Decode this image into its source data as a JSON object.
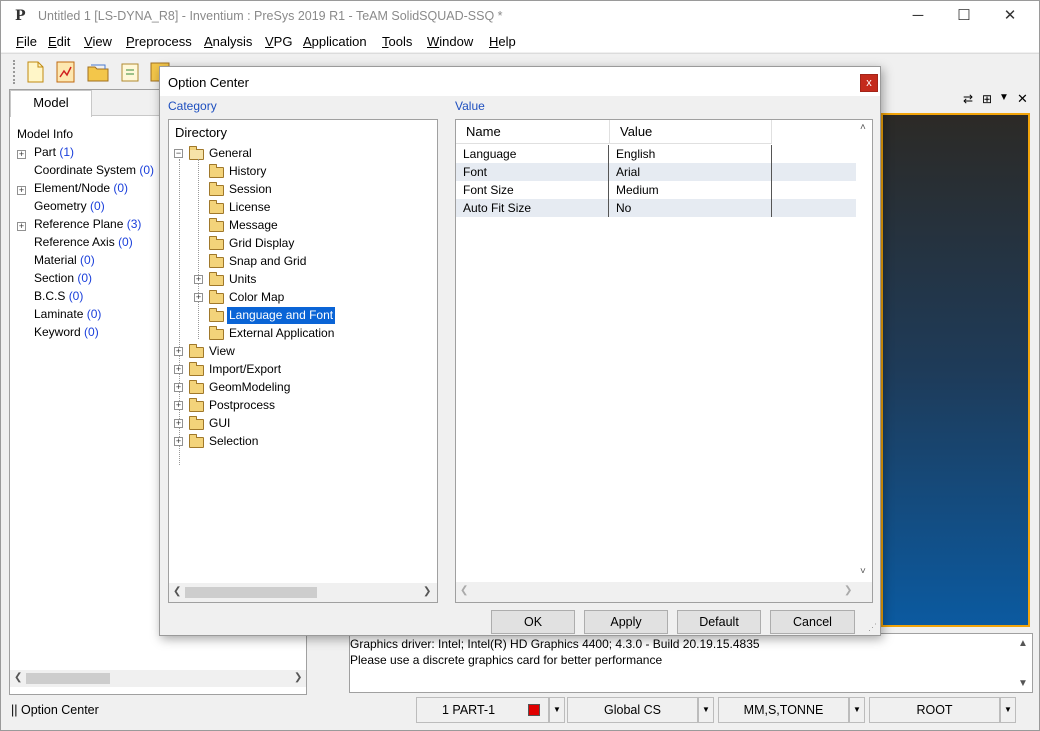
{
  "window": {
    "title": "Untitled 1 [LS-DYNA_R8] - Inventium : PreSys 2019 R1 - TeAM SolidSQUAD-SSQ *",
    "logo": "P",
    "minimize_glyph": "─",
    "maximize_glyph": "☐",
    "close_glyph": "✕"
  },
  "menubar": [
    {
      "hot": "F",
      "rest": "ile"
    },
    {
      "hot": "E",
      "rest": "dit"
    },
    {
      "hot": "V",
      "rest": "iew"
    },
    {
      "hot": "P",
      "rest": "reprocess"
    },
    {
      "hot": "A",
      "rest": "nalysis"
    },
    {
      "hot": "V",
      "rest": "PG"
    },
    {
      "hot": "A",
      "rest": "pplication"
    },
    {
      "hot": "T",
      "rest": "ools"
    },
    {
      "hot": "W",
      "rest": "indow"
    },
    {
      "hot": "H",
      "rest": "elp"
    }
  ],
  "left_panel": {
    "tab": "Model",
    "root": "Model Info",
    "items": [
      {
        "label": "Part",
        "count": "(1)",
        "expandable": true
      },
      {
        "label": "Coordinate System",
        "count": "(0)",
        "expandable": false
      },
      {
        "label": "Element/Node",
        "count": "(0)",
        "expandable": true
      },
      {
        "label": "Geometry",
        "count": "(0)",
        "expandable": false
      },
      {
        "label": "Reference Plane",
        "count": "(3)",
        "expandable": true
      },
      {
        "label": "Reference Axis",
        "count": "(0)",
        "expandable": false
      },
      {
        "label": "Material",
        "count": "(0)",
        "expandable": false
      },
      {
        "label": "Section",
        "count": "(0)",
        "expandable": false
      },
      {
        "label": "B.C.S",
        "count": "(0)",
        "expandable": false
      },
      {
        "label": "Laminate",
        "count": "(0)",
        "expandable": false
      },
      {
        "label": "Keyword",
        "count": "(0)",
        "expandable": false
      }
    ]
  },
  "console": {
    "lines": [
      "Graphics driver: Intel; Intel(R) HD Graphics 4400; 4.3.0 - Build 20.19.15.4835",
      "Please use a discrete graphics card for better performance"
    ]
  },
  "statusbar": {
    "left_text": "|| Option Center",
    "part": "1  PART-1",
    "part_color": "#e00000",
    "cs": "Global CS",
    "units": "MM,S,TONNE",
    "root": "ROOT"
  },
  "dialog": {
    "title": "Option Center",
    "close_glyph": "x",
    "category_label": "Category",
    "value_label": "Value",
    "directory_header": "Directory",
    "general": {
      "label": "General",
      "children": [
        "History",
        "Session",
        "License",
        "Message",
        "Grid Display",
        "Snap and Grid",
        "Units",
        "Color Map",
        "Language and Font",
        "External Application"
      ],
      "selected": "Language and Font"
    },
    "top_folders": [
      "View",
      "Import/Export",
      "GeomModeling",
      "Postprocess",
      "GUI",
      "Selection"
    ],
    "table": {
      "headers": [
        "Name",
        "Value"
      ],
      "rows": [
        {
          "name": "Language",
          "value": "English"
        },
        {
          "name": "Font",
          "value": "Arial"
        },
        {
          "name": "Font Size",
          "value": "Medium"
        },
        {
          "name": "Auto Fit Size",
          "value": "No"
        }
      ]
    },
    "buttons": {
      "ok": "OK",
      "apply": "Apply",
      "default": "Default",
      "cancel": "Cancel"
    }
  },
  "colors": {
    "selection": "#0a64d6",
    "link_count": "#1a3fdb",
    "group_label": "#1e4fbf",
    "viewport_border": "#f2a40a",
    "close_red": "#c42b1c"
  }
}
